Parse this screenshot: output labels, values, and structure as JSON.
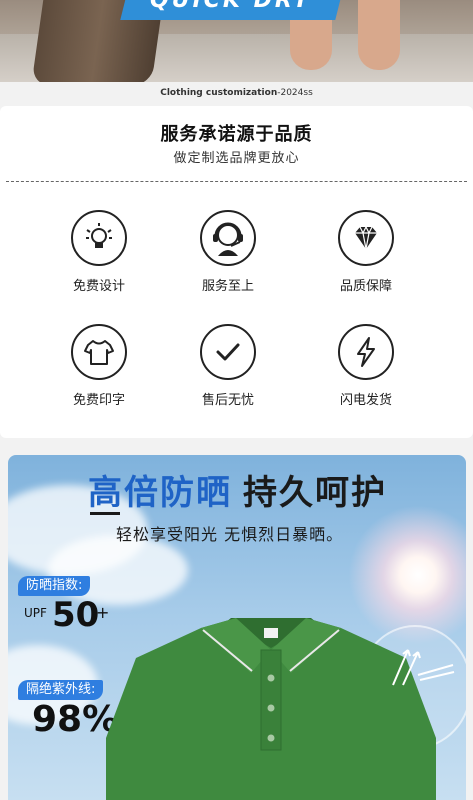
{
  "banner": {
    "text": "QUICK DRY"
  },
  "caption": {
    "main": "Clothing customization",
    "suffix": "-2024ss"
  },
  "service": {
    "title": "服务承诺源于品质",
    "subtitle": "做定制选品牌更放心",
    "features": [
      {
        "label": "免费设计",
        "icon": "lightbulb-icon"
      },
      {
        "label": "服务至上",
        "icon": "headset-support-icon"
      },
      {
        "label": "品质保障",
        "icon": "diamond-icon"
      },
      {
        "label": "免费印字",
        "icon": "tshirt-icon"
      },
      {
        "label": "售后无忧",
        "icon": "checkmark-icon"
      },
      {
        "label": "闪电发货",
        "icon": "lightning-icon"
      }
    ]
  },
  "sun": {
    "heading_blue": "高倍防晒",
    "heading_dark": "持久呵护",
    "tagline": "轻松享受阳光 无惧烈日暴晒。",
    "upf_label": "防晒指数:",
    "upf_prefix": "UPF",
    "upf_value": "50",
    "upf_plus": "+",
    "uv_label": "隔绝紫外线:",
    "uv_value": "98%"
  },
  "colors": {
    "accent_blue": "#1f63c6",
    "pill_blue": "#2f7ee0",
    "shirt_green": "#3f8a3f"
  }
}
